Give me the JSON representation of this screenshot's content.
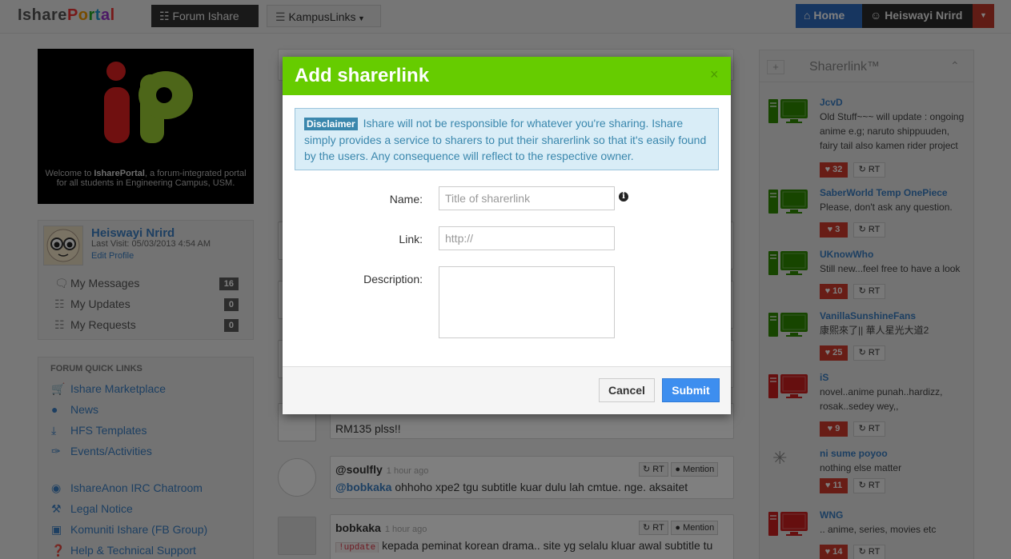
{
  "navbar": {
    "logo": "IsharePortal",
    "forum_label": "Forum Ishare",
    "kampus_label": "KampusLinks",
    "home_label": "Home",
    "user_label": "Heiswayi Nrird"
  },
  "promo": {
    "logo_text": "iP",
    "welcome_prefix": "Welcome to ",
    "welcome_brand": "IsharePortal",
    "welcome_suffix": ", a forum-integrated portal for all students in Engineering Campus, USM."
  },
  "profile": {
    "name": "Heiswayi Nrird",
    "last_visit": "Last Visit: 05/03/2013 4:54 AM",
    "edit": "Edit Profile",
    "menu": [
      {
        "label": "My Messages",
        "count": "16"
      },
      {
        "label": "My Updates",
        "count": "0"
      },
      {
        "label": "My Requests",
        "count": "0"
      }
    ]
  },
  "quicklinks": {
    "title": "FORUM QUICK LINKS",
    "items": [
      {
        "label": "Ishare Marketplace",
        "icon": "cart-icon"
      },
      {
        "label": "News",
        "icon": "globe-icon"
      },
      {
        "label": "HFS Templates",
        "icon": "download-icon"
      },
      {
        "label": "Events/Activities",
        "icon": "pin-icon"
      },
      {
        "label": "IshareAnon IRC Chatroom",
        "icon": "eye-icon"
      },
      {
        "label": "Legal Notice",
        "icon": "gavel-icon"
      },
      {
        "label": "Komuniti Ishare (FB Group)",
        "icon": "facebook-icon"
      },
      {
        "label": "Help & Technical Support",
        "icon": "question-icon"
      }
    ]
  },
  "feed": {
    "partial_text": "RM135 plss!!",
    "posts": [
      {
        "user": "@soulfly",
        "time": "1 hour ago",
        "mention": "@bobkaka",
        "text": " ohhoho xpe2 tgu subtitle kuar dulu lah cmtue. nge. aksaitet",
        "rt": "RT",
        "mention_btn": "Mention"
      },
      {
        "user": "bobkaka",
        "time": "1 hour ago",
        "tag": "!update",
        "text": "kepada peminat korean drama.. site yg selalu kluar awal subtitle tu",
        "rt": "RT",
        "mention_btn": "Mention"
      }
    ]
  },
  "sharerlink": {
    "title": "Sharerlink™",
    "items": [
      {
        "name": "JcvD",
        "desc": "Old Stuff~~~ will update : ongoing anime e.g; naruto shippuuden, fairy tail also kamen rider project",
        "likes": "32",
        "rt": "RT",
        "status": "online"
      },
      {
        "name": "SaberWorld Temp OnePiece",
        "desc": "Please, don't ask any question.",
        "likes": "3",
        "rt": "RT",
        "status": "online"
      },
      {
        "name": "UKnowWho",
        "desc": "Still new...feel free to have a look",
        "likes": "10",
        "rt": "RT",
        "status": "online"
      },
      {
        "name": "VanillaSunshineFans",
        "desc": "康熙來了|| 華人星光大道2",
        "likes": "25",
        "rt": "RT",
        "status": "online"
      },
      {
        "name": "iS",
        "desc": "novel..anime punah..hardizz, rosak..sedey wey,,",
        "likes": "9",
        "rt": "RT",
        "status": "offline"
      },
      {
        "name": "ni sume poyoo",
        "desc": "nothing else matter",
        "likes": "11",
        "rt": "RT",
        "status": "loading"
      },
      {
        "name": "WNG",
        "desc": ".. anime, series, movies etc",
        "likes": "14",
        "rt": "RT",
        "status": "offline"
      }
    ]
  },
  "modal": {
    "title": "Add sharerlink",
    "close": "×",
    "disclaimer_badge": "Disclaimer",
    "disclaimer_text": " Ishare will not be responsible for whatever you're sharing. Ishare simply provides a service to sharers to put their sharerlink so that it's easily found by the users. Any consequence will reflect to the respective owner.",
    "name_label": "Name:",
    "name_placeholder": "Title of sharerlink",
    "link_label": "Link:",
    "link_placeholder": "http://",
    "desc_label": "Description:",
    "cancel": "Cancel",
    "submit": "Submit"
  },
  "colors": {
    "modal_header": "#66cc00",
    "online": "#2e8b00",
    "offline": "#cc1f1f",
    "submit": "#3d8eef"
  }
}
